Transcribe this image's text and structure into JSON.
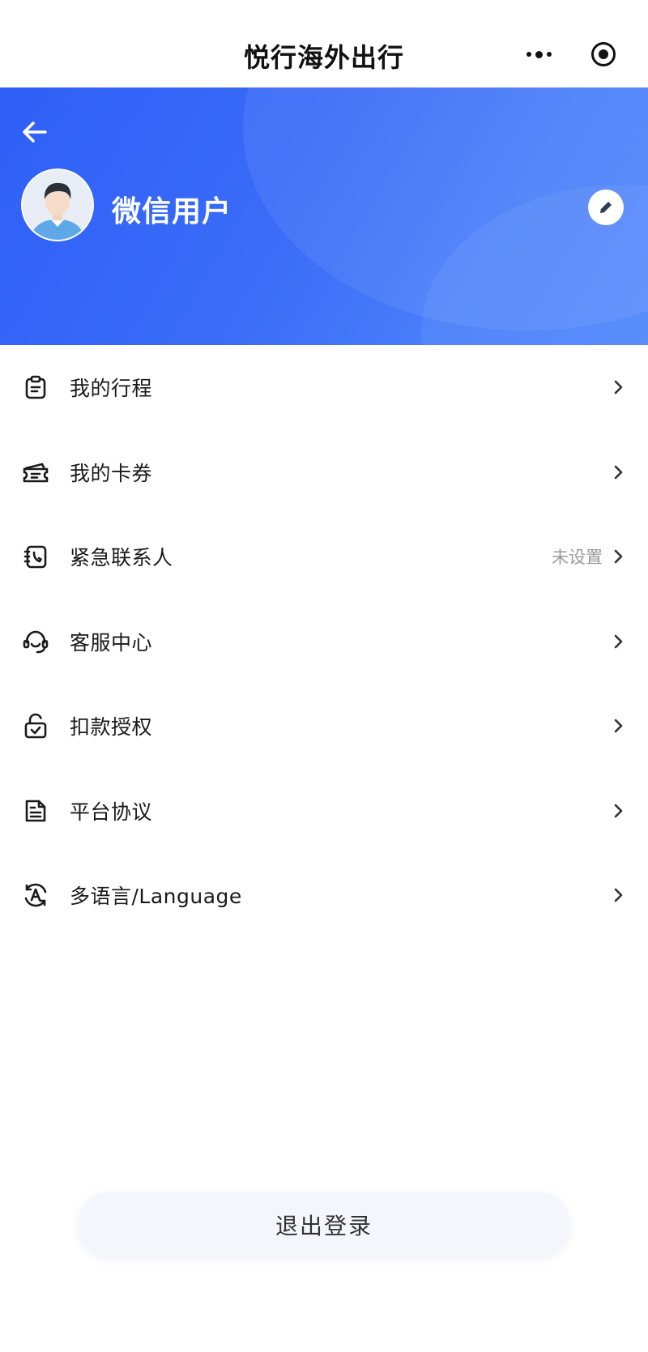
{
  "app": {
    "title": "悦行海外出行"
  },
  "profile": {
    "name": "微信用户"
  },
  "menu": [
    {
      "label": "我的行程",
      "value": "",
      "icon": "clipboard-icon"
    },
    {
      "label": "我的卡券",
      "value": "",
      "icon": "ticket-icon"
    },
    {
      "label": "紧急联系人",
      "value": "未设置",
      "icon": "phone-contact-icon"
    },
    {
      "label": "客服中心",
      "value": "",
      "icon": "headset-icon"
    },
    {
      "label": "扣款授权",
      "value": "",
      "icon": "unlock-icon"
    },
    {
      "label": "平台协议",
      "value": "",
      "icon": "document-icon"
    },
    {
      "label": "多语言/Language",
      "value": "",
      "icon": "language-icon"
    }
  ],
  "logout": {
    "label": "退出登录"
  },
  "colors": {
    "header_blue": "#3366f8",
    "text": "#1a1a1a",
    "muted": "#9a9a9a",
    "logout_bg": "#f3f7fc"
  }
}
